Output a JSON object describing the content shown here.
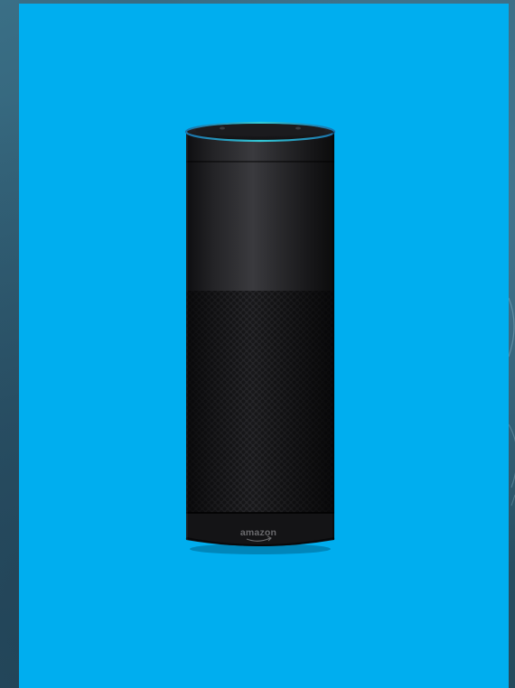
{
  "image": {
    "subject": "smart-speaker",
    "colors": {
      "backdrop": "#2f5b70",
      "slide": "#00aeef",
      "device_body": "#1b1b1d",
      "light_ring": "#2aa7c8",
      "logo": "#6a6a6d"
    },
    "logo_text": "amazon"
  }
}
